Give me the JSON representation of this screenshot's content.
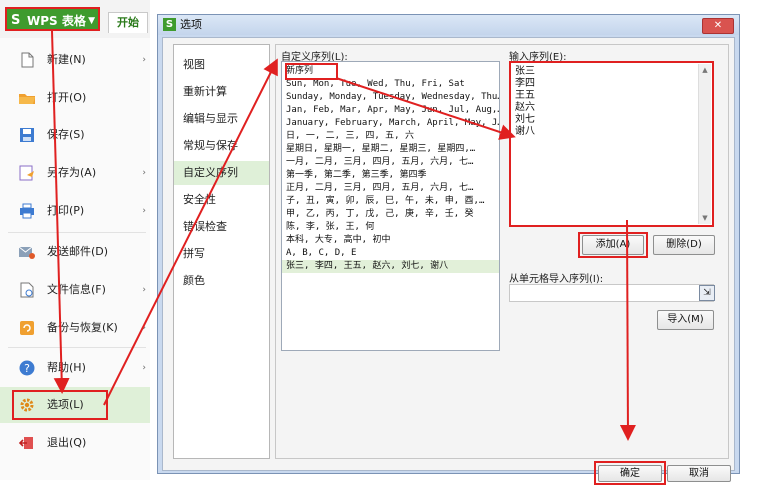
{
  "wps": {
    "app_button": "WPS 表格",
    "logo": "S",
    "tab_start": "开始",
    "menu": [
      {
        "label": "新建(N)",
        "icon": "new-file-icon",
        "arrow": "›"
      },
      {
        "label": "打开(O)",
        "icon": "folder-icon",
        "arrow": ""
      },
      {
        "label": "保存(S)",
        "icon": "save-icon",
        "arrow": ""
      },
      {
        "label": "另存为(A)",
        "icon": "save-as-icon",
        "arrow": "›"
      },
      {
        "label": "打印(P)",
        "icon": "print-icon",
        "arrow": "›"
      },
      {
        "label": "发送邮件(D)",
        "icon": "mail-icon",
        "arrow": ""
      },
      {
        "label": "文件信息(F)",
        "icon": "file-info-icon",
        "arrow": "›"
      },
      {
        "label": "备份与恢复(K)",
        "icon": "backup-icon",
        "arrow": "›"
      },
      {
        "label": "帮助(H)",
        "icon": "help-icon",
        "arrow": "›"
      },
      {
        "label": "选项(L)",
        "icon": "gear-icon",
        "arrow": ""
      },
      {
        "label": "退出(Q)",
        "icon": "exit-icon",
        "arrow": ""
      }
    ]
  },
  "dialog": {
    "logo": "S",
    "title": "选项",
    "close": "✕",
    "nav": [
      "视图",
      "重新计算",
      "编辑与显示",
      "常规与保存",
      "自定义序列",
      "安全性",
      "错误检查",
      "拼写",
      "颜色"
    ],
    "selected_nav": 4,
    "custom_list_label": "自定义序列(L):",
    "custom_list": [
      "新序列",
      "Sun, Mon, Tue, Wed, Thu, Fri, Sat",
      "Sunday, Monday, Tuesday, Wednesday, Thu…",
      "Jan, Feb, Mar, Apr, May, Jun, Jul, Aug,…",
      "January, February, March, April, May, J…",
      "日, 一, 二, 三, 四, 五, 六",
      "星期日, 星期一, 星期二, 星期三, 星期四,…",
      "一月, 二月, 三月, 四月, 五月, 六月, 七…",
      "第一季, 第二季, 第三季, 第四季",
      "正月, 二月, 三月, 四月, 五月, 六月, 七…",
      "子, 丑, 寅, 卯, 辰, 巳, 午, 未, 申, 酉,…",
      "甲, 乙, 丙, 丁, 戊, 己, 庚, 辛, 壬, 癸",
      "陈, 李, 张, 王, 何",
      "本科, 大专, 高中, 初中",
      "A, B, C, D, E",
      "张三, 李四, 王五, 赵六, 刘七, 谢八"
    ],
    "input_label": "输入序列(E):",
    "input_lines": [
      "张三",
      "李四",
      "王五",
      "赵六",
      "刘七",
      "谢八"
    ],
    "add_button": "添加(A)",
    "delete_button": "删除(D)",
    "import_label": "从单元格导入序列(I):",
    "import_value": "",
    "import_button": "导入(M)",
    "ok_button": "确定",
    "cancel_button": "取消"
  },
  "colors": {
    "accent_green": "#3f9b2e",
    "highlight_red": "#e02020",
    "selection": "#dff0d8"
  }
}
